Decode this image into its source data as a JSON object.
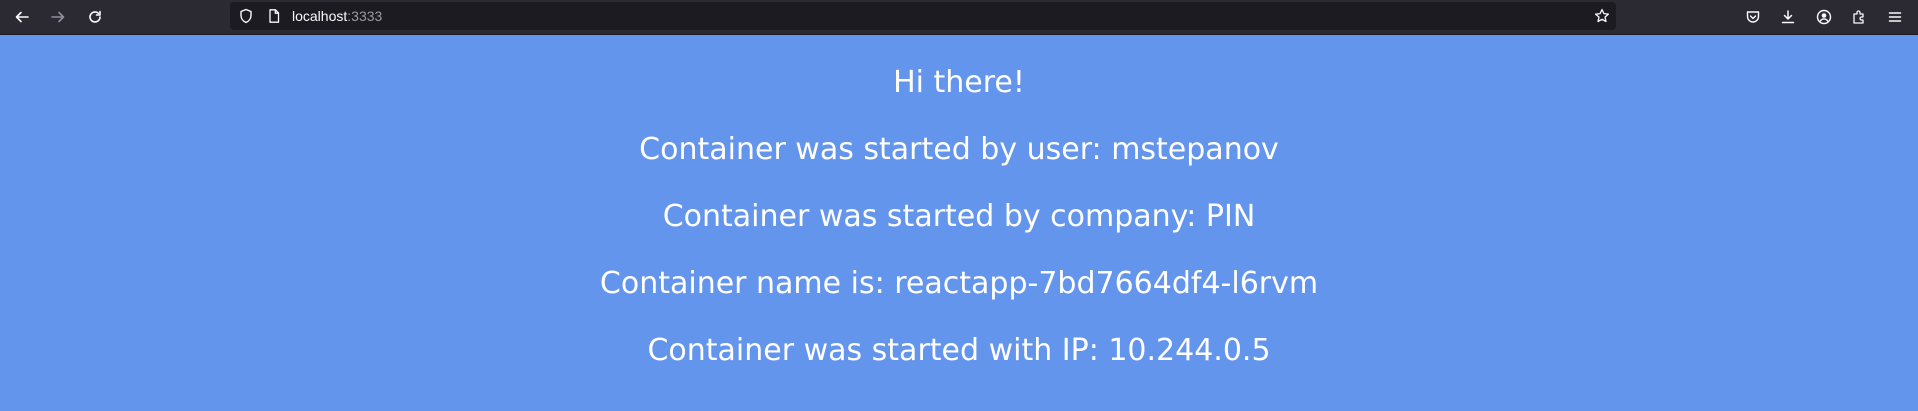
{
  "browser": {
    "url_host": "localhost",
    "url_port": ":3333",
    "icons": [
      "back-icon",
      "forward-icon",
      "reload-icon",
      "shield-icon",
      "page-icon",
      "star-icon",
      "pocket-icon",
      "download-icon",
      "account-icon",
      "extensions-icon",
      "menu-icon"
    ]
  },
  "page": {
    "greeting": "Hi there!",
    "user_line": "Container was started by user: mstepanov",
    "company_line": "Container was started by company: PIN",
    "name_line": "Container name is: reactapp-7bd7664df4-l6rvm",
    "ip_line": "Container was started with IP: 10.244.0.5"
  },
  "colors": {
    "background": "#6495ed",
    "text": "#ffffff",
    "toolbar": "#2b2a33",
    "urlbar": "#1c1b22"
  }
}
